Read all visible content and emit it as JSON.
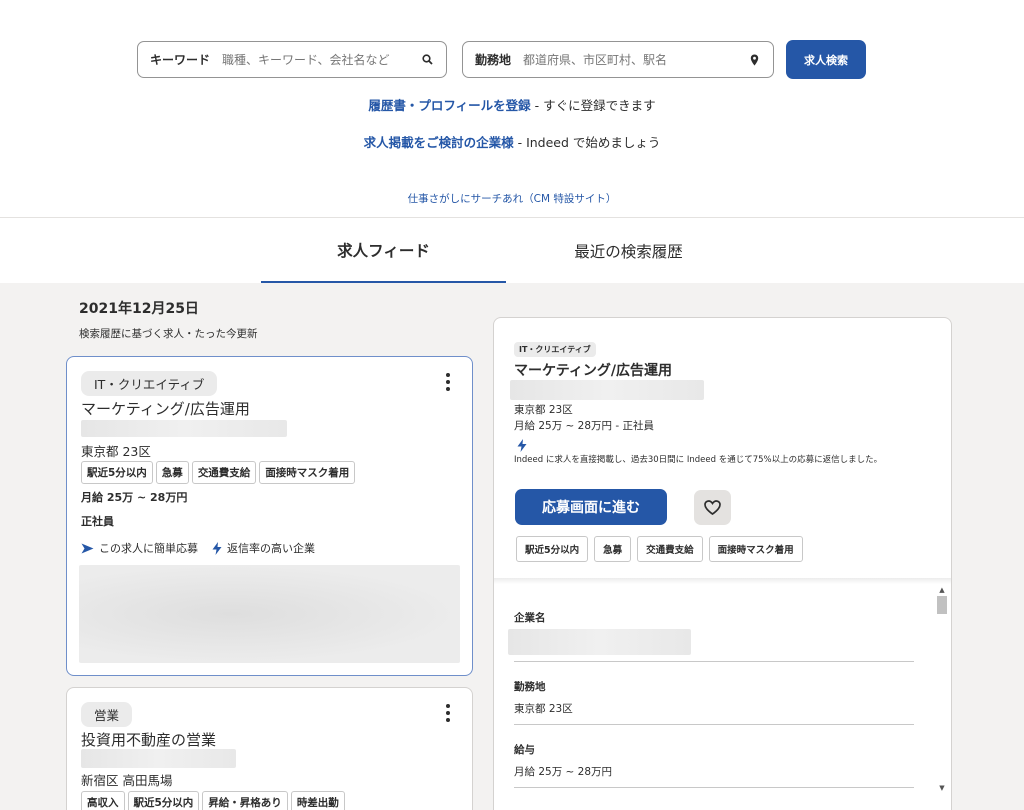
{
  "search": {
    "keyword_label": "キーワード",
    "keyword_placeholder": "職種、キーワード、会社名など",
    "location_label": "勤務地",
    "location_placeholder": "都道府県、市区町村、駅名",
    "button_label": "求人検索"
  },
  "promo": {
    "resume_link": "履歴書・プロフィールを登録",
    "resume_tail": " - すぐに登録できます",
    "employer_link": "求人掲載をご検討の企業様",
    "employer_tail": " - Indeed で始めましょう",
    "cm_link": "仕事さがしにサーチあれ（CM 特設サイト）"
  },
  "tabs": [
    {
      "label": "求人フィード",
      "active": true
    },
    {
      "label": "最近の検索履歴",
      "active": false
    }
  ],
  "feed": {
    "date": "2021年12月25日",
    "subtitle": "検索履歴に基づく求人・たった今更新",
    "cards": [
      {
        "category": "IT・クリエイティブ",
        "title": "マーケティング/広告運用",
        "location": "東京都 23区",
        "tags": [
          "駅近5分以内",
          "急募",
          "交通費支給",
          "面接時マスク着用"
        ],
        "salary": "月給 25万 ~ 28万円",
        "employment": "正社員",
        "feature_easy_apply": "この求人に簡単応募",
        "feature_responsive": "返信率の高い企業"
      },
      {
        "category": "営業",
        "title": "投資用不動産の営業",
        "location": "新宿区 高田馬場",
        "tags": [
          "高収入",
          "駅近5分以内",
          "昇給・昇格あり",
          "時差出勤"
        ]
      }
    ]
  },
  "detail": {
    "category": "IT・クリエイティブ",
    "title": "マーケティング/広告運用",
    "location": "東京都 23区",
    "salary_line": "月給 25万 ~ 28万円  - 正社員",
    "note": "Indeed に求人を直接掲載し、過去30日間に Indeed を通じて75%以上の応募に返信しました。",
    "apply_label": "応募画面に進む",
    "tags": [
      "駅近5分以内",
      "急募",
      "交通費支給",
      "面接時マスク着用"
    ],
    "sections": [
      {
        "heading": "企業名",
        "value": ""
      },
      {
        "heading": "勤務地",
        "value": "東京都 23区"
      },
      {
        "heading": "給与",
        "value": "月給 25万 ~ 28万円"
      }
    ]
  },
  "colors": {
    "accent": "#2557a7"
  }
}
